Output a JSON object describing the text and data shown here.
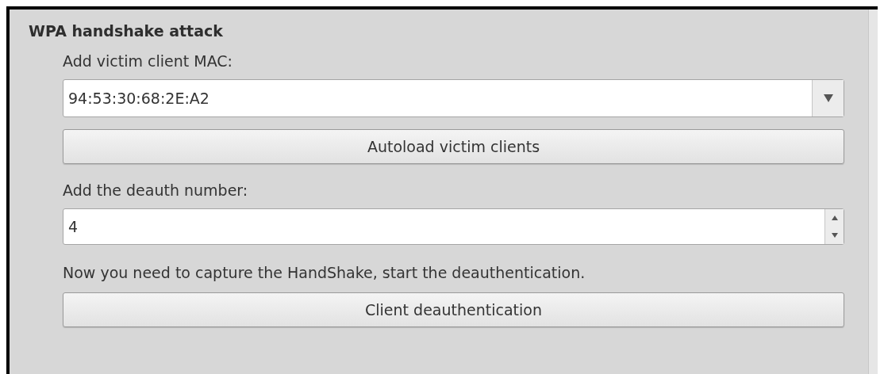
{
  "group": {
    "title": "WPA handshake attack"
  },
  "mac_label": "Add victim client MAC:",
  "mac_combo": {
    "value": "94:53:30:68:2E:A2"
  },
  "autoload_button": "Autoload victim clients",
  "deauth_label": "Add the deauth number:",
  "deauth_spin": {
    "value": "4"
  },
  "instruction": "Now you need to capture the HandShake, start the deauthentication.",
  "deauth_button": "Client deauthentication"
}
